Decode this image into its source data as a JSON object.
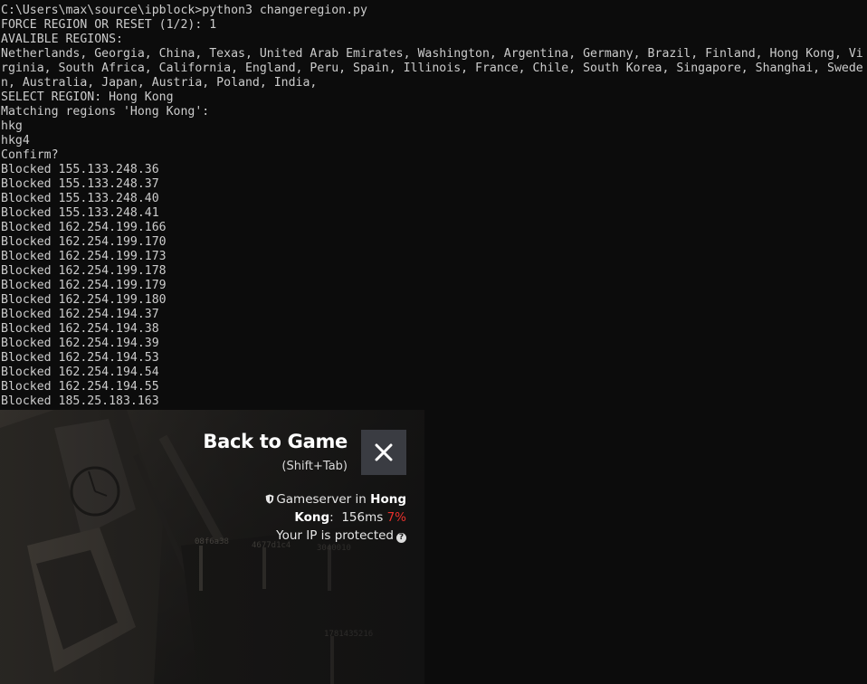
{
  "terminal": {
    "lines": [
      "C:\\Users\\max\\source\\ipblock>python3 changeregion.py",
      "FORCE REGION OR RESET (1/2): 1",
      "AVALIBLE REGIONS:",
      "Netherlands, Georgia, China, Texas, United Arab Emirates, Washington, Argentina, Germany, Brazil, Finland, Hong Kong, Vi",
      "rginia, South Africa, California, England, Peru, Spain, Illinois, France, Chile, South Korea, Singapore, Shanghai, Swede",
      "n, Australia, Japan, Austria, Poland, India,",
      "SELECT REGION: Hong Kong",
      "Matching regions 'Hong Kong':",
      "hkg",
      "hkg4",
      "Confirm?",
      "Blocked 155.133.248.36",
      "Blocked 155.133.248.37",
      "Blocked 155.133.248.40",
      "Blocked 155.133.248.41",
      "Blocked 162.254.199.166",
      "Blocked 162.254.199.170",
      "Blocked 162.254.199.173",
      "Blocked 162.254.199.178",
      "Blocked 162.254.199.179",
      "Blocked 162.254.199.180",
      "Blocked 162.254.194.37",
      "Blocked 162.254.194.38",
      "Blocked 162.254.194.39",
      "Blocked 162.254.194.53",
      "Blocked 162.254.194.54",
      "Blocked 162.254.194.55",
      "Blocked 185.25.183.163"
    ]
  },
  "overlay": {
    "title": "Back to Game",
    "shortcut": "(Shift+Tab)",
    "close_icon": "close-icon",
    "server": {
      "prefix": "Gameserver in",
      "region_part1": "Hong",
      "region_part2": "Kong",
      "colon": ":",
      "ping": "156ms",
      "loss": "7%",
      "protected_text": "Your IP is protected",
      "shield_icon": "shield-icon",
      "help_icon": "help-icon"
    },
    "background_texts": [
      "08f6a38",
      "4677d1c4",
      "3040010",
      "1781435216"
    ]
  },
  "colors": {
    "terminal_bg": "#0c0c0c",
    "terminal_text": "#cccccc",
    "close_button_bg": "#3a3c42",
    "loss_red": "#e8302c"
  }
}
